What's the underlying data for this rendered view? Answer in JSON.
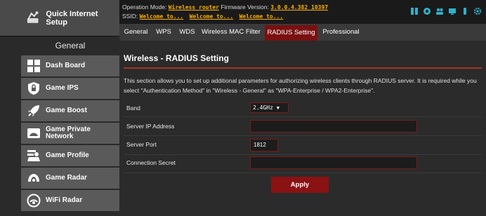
{
  "quick_setup": {
    "label": "Quick Internet Setup",
    "icon": "wizard-icon"
  },
  "sidebar": {
    "section_title": "General",
    "items": [
      {
        "label": "Dash Board",
        "icon": "dashboard-icon"
      },
      {
        "label": "Game IPS",
        "icon": "shield-lock-icon"
      },
      {
        "label": "Game Boost",
        "icon": "rocket-icon"
      },
      {
        "label": "Game Private Network",
        "icon": "private-network-icon"
      },
      {
        "label": "Game Profile",
        "icon": "game-profile-icon"
      },
      {
        "label": "Game Radar",
        "icon": "game-radar-icon"
      },
      {
        "label": "WiFi Radar",
        "icon": "wifi-radar-icon"
      }
    ]
  },
  "header": {
    "operation_mode_label": "Operation Mode:",
    "operation_mode_value": "Wireless router",
    "firmware_label": "Firmware Version:",
    "firmware_value": "3.0.0.4.382_10397",
    "ssid_label": "SSID:",
    "ssids": [
      "Welcome to...",
      "Welcome to...",
      "Welcome to..."
    ],
    "status_icons": [
      "network-map-icon",
      "settings-gear-icon",
      "users-icon",
      "display-icon",
      "usb-icon",
      "gear-icon"
    ]
  },
  "tabs": [
    {
      "label": "General",
      "active": false
    },
    {
      "label": "WPS",
      "active": false
    },
    {
      "label": "WDS",
      "active": false
    },
    {
      "label": "Wireless MAC Filter",
      "active": false
    },
    {
      "label": "RADIUS Setting",
      "active": true
    },
    {
      "label": "Professional",
      "active": false
    }
  ],
  "main": {
    "title": "Wireless - RADIUS Setting",
    "description": "This section allows you to set up additional parameters for authorizing wireless clients through RADIUS server. It is required while you select \"Authentication Method\" in \"Wireless - General\" as \"WPA-Enterprise / WPA2-Enterprise\".",
    "fields": {
      "band": {
        "label": "Band",
        "value": "2.4GHz"
      },
      "server_ip": {
        "label": "Server IP Address",
        "value": ""
      },
      "server_port": {
        "label": "Server Port",
        "value": "1812"
      },
      "connection_secret": {
        "label": "Connection Secret",
        "value": ""
      }
    },
    "apply_label": "Apply"
  },
  "colors": {
    "accent_red": "#8a1212",
    "active_tab": "#7a1010",
    "title_rule": "#a83226",
    "highlight_text": "#ffb200",
    "status_icon": "#2fb0c8"
  }
}
